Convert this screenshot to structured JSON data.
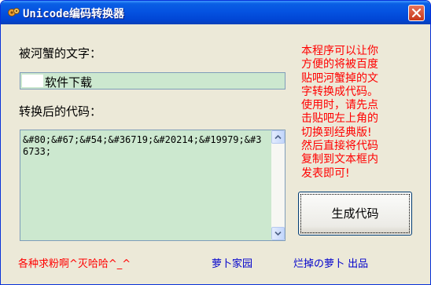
{
  "window": {
    "title": "Unicode编码转换器",
    "icon": "gear-app-icon",
    "colors": {
      "titlebar": "#0553e1",
      "close": "#d3472c",
      "field_bg": "#cce8cf",
      "info_text": "#ff0000",
      "link_text": "#0000cc"
    }
  },
  "source": {
    "label": "被河蟹的文字：",
    "value": "软件下载"
  },
  "result": {
    "label": "转换后的代码：",
    "value": "&#80;&#67;&#54;&#36719;&#20214;&#19979;&#36733;"
  },
  "info_lines": [
    "本程序可以让你",
    "方便的将被百度",
    "贴吧河蟹掉的文",
    "字转换成代码。",
    "使用时，请先点",
    "击贴吧左上角的",
    "切换到经典版!",
    "然后直接将代码",
    "复制到文本框内",
    "发表即可!"
  ],
  "generate_button": {
    "label": "生成代码"
  },
  "footer": {
    "left": "各种求粉啊^灭哈哈^_^",
    "site": "萝卜家园",
    "credit": "烂掉の萝卜 出品"
  }
}
